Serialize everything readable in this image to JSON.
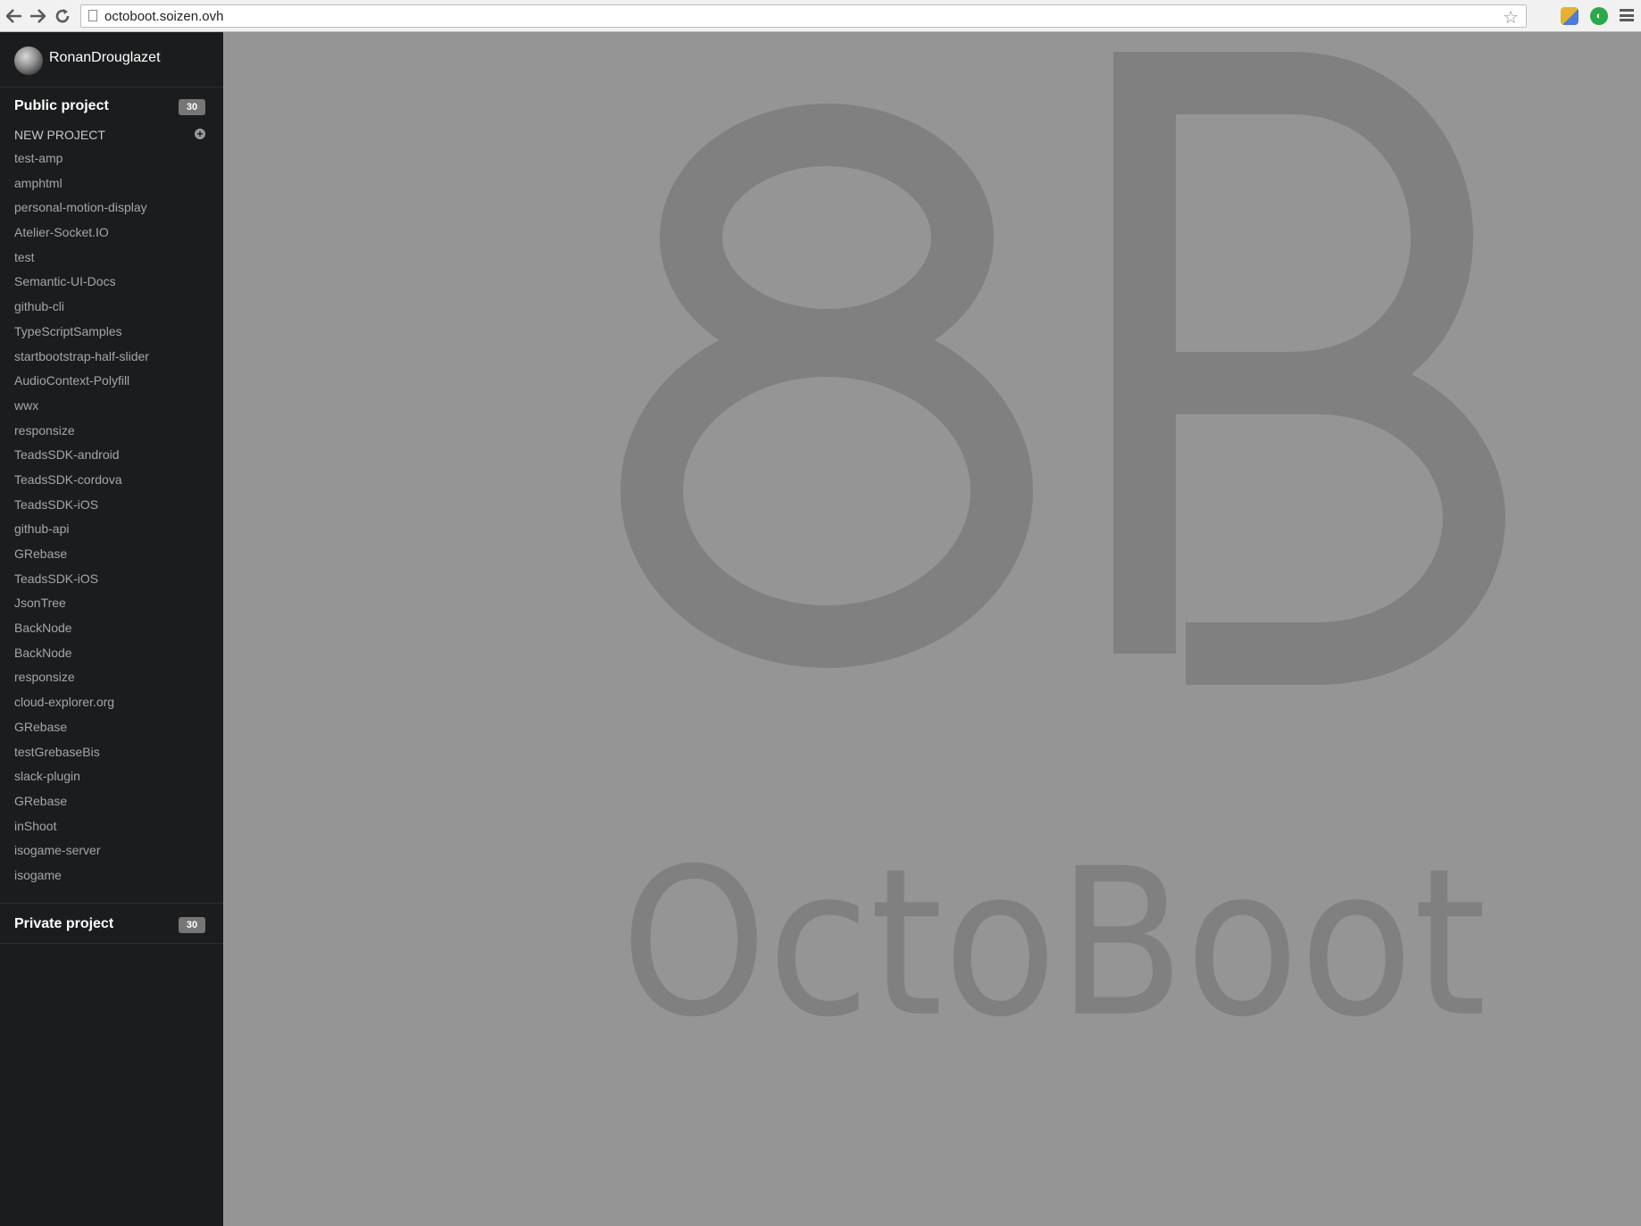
{
  "browser": {
    "url": "octoboot.soizen.ovh",
    "icons": [
      "back-arrow-icon",
      "forward-arrow-icon",
      "reload-icon",
      "page-icon",
      "star-icon",
      "extension-icon",
      "extension-icon",
      "menu-icon"
    ]
  },
  "sidebar": {
    "username": "RonanDrouglazet",
    "public_section": {
      "title": "Public project",
      "count": "30",
      "new_project_label": "NEW PROJECT",
      "projects": [
        "test-amp",
        "amphtml",
        "personal-motion-display",
        "Atelier-Socket.IO",
        "test",
        "Semantic-UI-Docs",
        "github-cli",
        "TypeScriptSamples",
        "startbootstrap-half-slider",
        "AudioContext-Polyfill",
        "wwx",
        "responsize",
        "TeadsSDK-android",
        "TeadsSDK-cordova",
        "TeadsSDK-iOS",
        "github-api",
        "GRebase",
        "TeadsSDK-iOS",
        "JsonTree",
        "BackNode",
        "BackNode",
        "responsize",
        "cloud-explorer.org",
        "GRebase",
        "testGrebaseBis",
        "slack-plugin",
        "GRebase",
        "inShoot",
        "isogame-server",
        "isogame"
      ]
    },
    "private_section": {
      "title": "Private project",
      "count": "30"
    }
  },
  "main": {
    "logo_mark": "8B",
    "logo_text": "OctoBoot",
    "background_color": "#959595",
    "logo_color": "#808080"
  }
}
